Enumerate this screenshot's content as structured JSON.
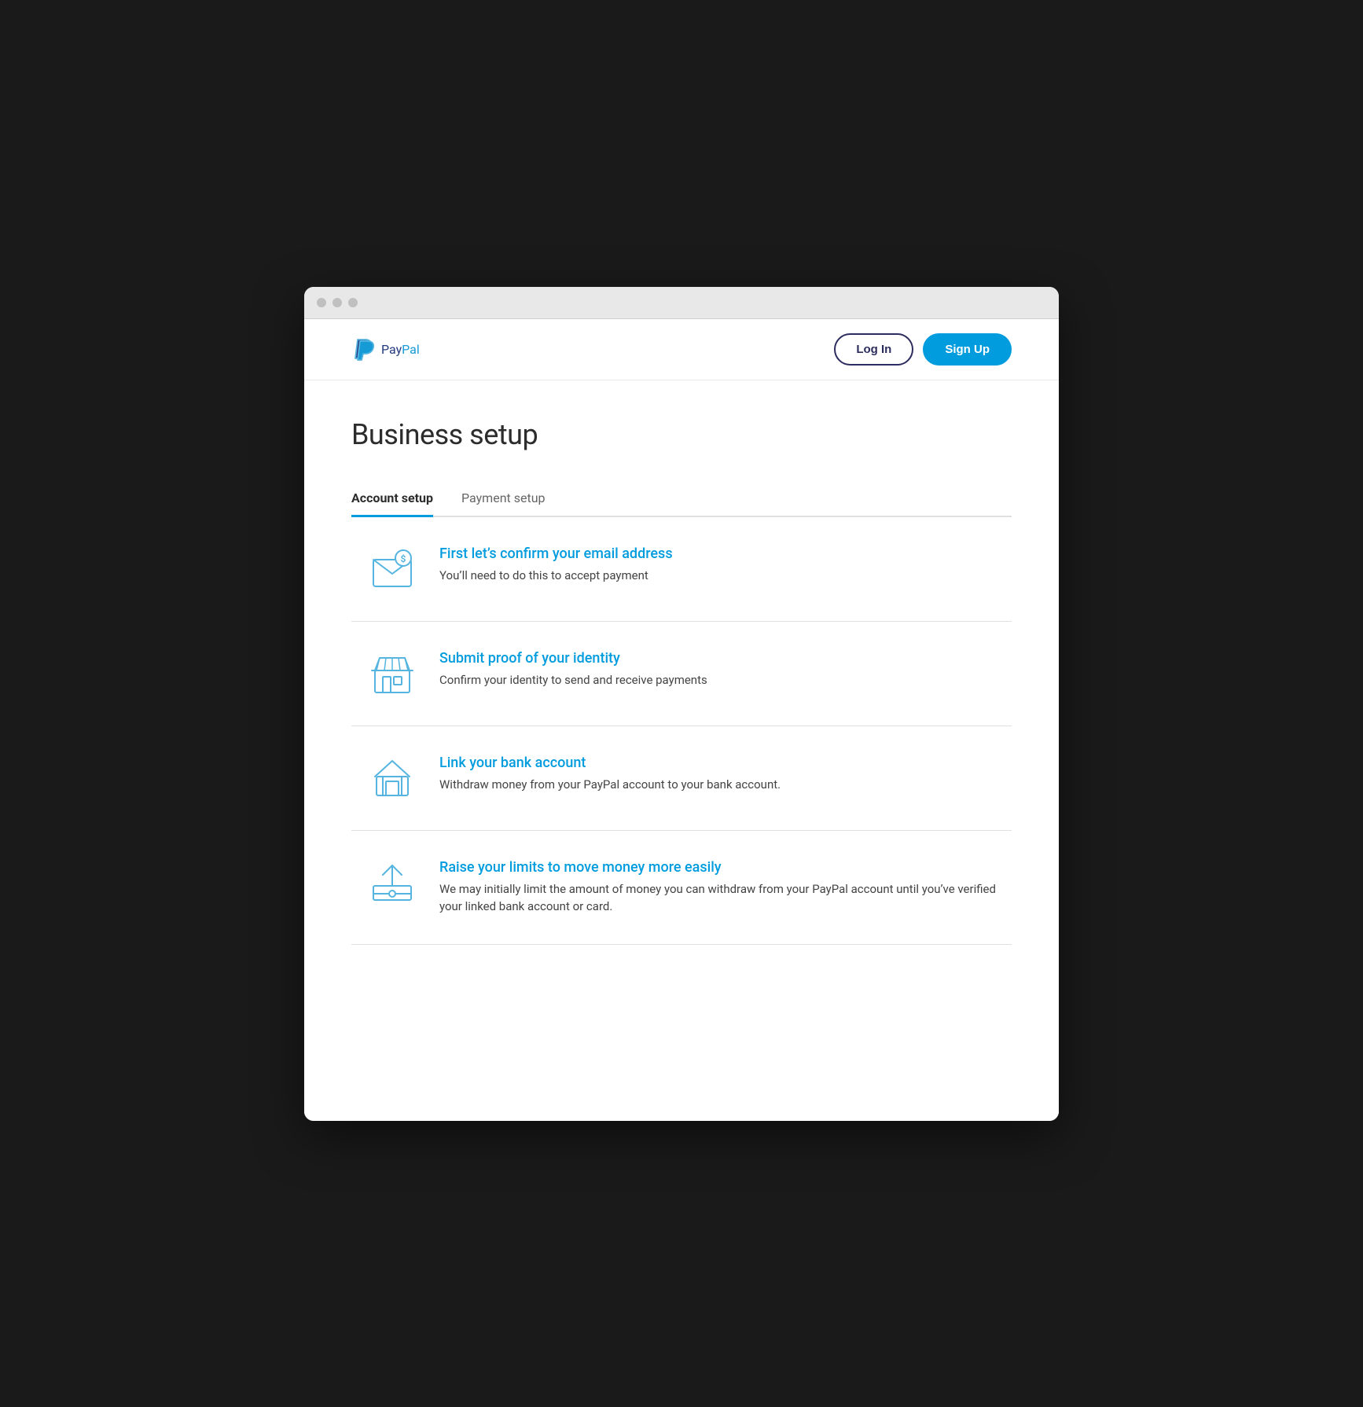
{
  "browser": {
    "dots": [
      "dot1",
      "dot2",
      "dot3"
    ]
  },
  "navbar": {
    "logo_pay": "Pay",
    "logo_pal": "Pal",
    "login_label": "Log In",
    "signup_label": "Sign Up"
  },
  "page": {
    "title": "Business setup"
  },
  "tabs": [
    {
      "id": "account-setup",
      "label": "Account setup",
      "active": true
    },
    {
      "id": "payment-setup",
      "label": "Payment setup",
      "active": false
    }
  ],
  "setup_items": [
    {
      "id": "email",
      "title": "First let’s confirm your email address",
      "description": "You’ll need to do this to accept payment",
      "icon": "email-icon"
    },
    {
      "id": "identity",
      "title": "Submit proof of your identity",
      "description": "Confirm your identity to send and receive payments",
      "icon": "store-icon"
    },
    {
      "id": "bank",
      "title": "Link your bank account",
      "description": "Withdraw money from your PayPal account to your bank account.",
      "icon": "bank-icon"
    },
    {
      "id": "limits",
      "title": "Raise your limits to move money more easily",
      "description": "We may initially limit the amount of money you can withdraw from your PayPal account until you’ve verified your linked bank account or card.",
      "icon": "upload-icon"
    }
  ],
  "colors": {
    "accent_blue": "#009cde",
    "dark_blue": "#253b80",
    "icon_blue": "#55b5e0"
  }
}
